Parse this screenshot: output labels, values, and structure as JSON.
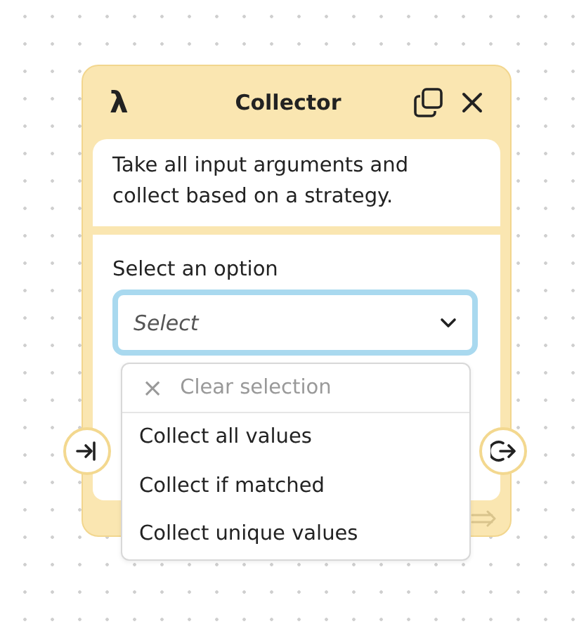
{
  "node": {
    "icon": "λ",
    "title": "Collector",
    "description": "Take all input arguments and collect based on a strategy.",
    "field": {
      "label": "Select an option",
      "placeholder": "Select",
      "focused": true,
      "expanded": true
    },
    "menu": {
      "clear": {
        "icon": "×",
        "label": "Clear selection"
      },
      "options": [
        {
          "label": "Collect all values",
          "selected": false
        },
        {
          "label": "Collect if matched",
          "selected": false
        },
        {
          "label": "Collect unique values",
          "selected": false
        }
      ]
    }
  }
}
